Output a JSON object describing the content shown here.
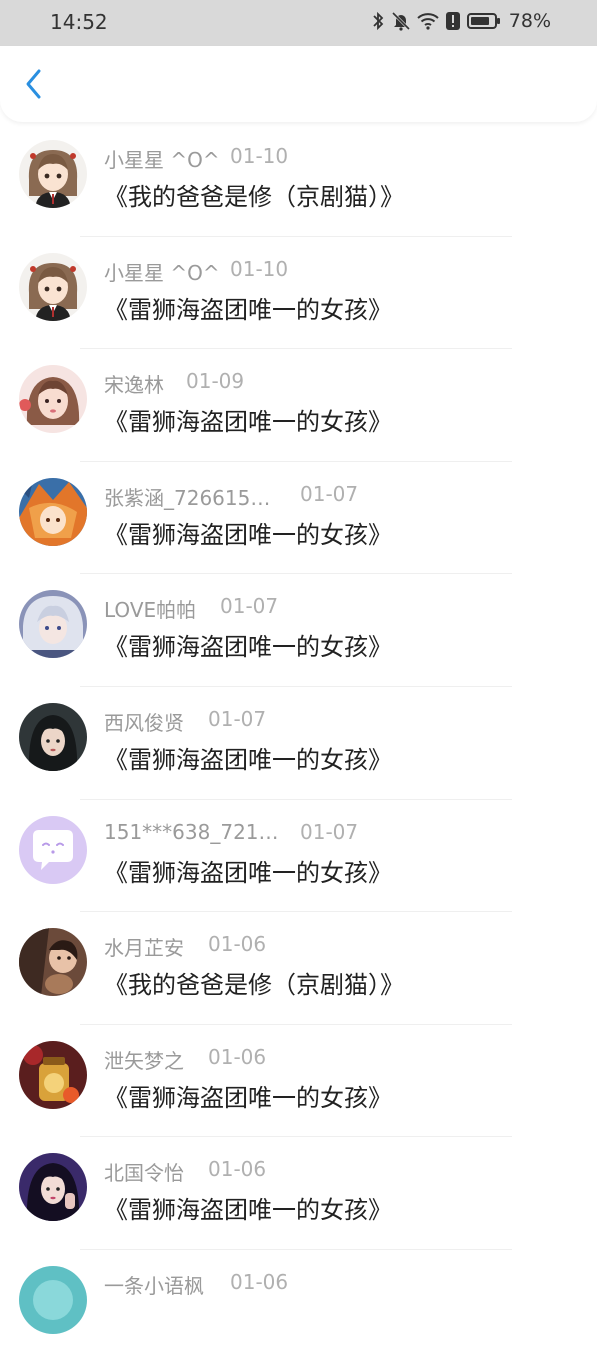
{
  "status_bar": {
    "time": "14:52",
    "battery": "78%",
    "icons": [
      "bluetooth-icon",
      "mute-bell-icon",
      "wifi-icon",
      "alert-icon",
      "battery-icon"
    ]
  },
  "header": {
    "back_icon": "chevron-left-icon",
    "accent_color": "#2a8fe0"
  },
  "comments": [
    {
      "name": "小星星 ^O^",
      "date": "01-10",
      "title": "《我的爸爸是修（京剧猫）》",
      "avatar": "anime-girl"
    },
    {
      "name": "小星星 ^O^",
      "date": "01-10",
      "title": "《雷狮海盗团唯一的女孩》",
      "avatar": "anime-girl"
    },
    {
      "name": "宋逸林",
      "date": "01-09",
      "title": "《雷狮海盗团唯一的女孩》",
      "avatar": "pink-girl"
    },
    {
      "name": "张紫涵_726615…",
      "date": "01-07",
      "title": "《雷狮海盗团唯一的女孩》",
      "avatar": "orange-fox"
    },
    {
      "name": "LOVE帕帕",
      "date": "01-07",
      "title": "《雷狮海盗团唯一的女孩》",
      "avatar": "silver-hair"
    },
    {
      "name": "西风俊贤",
      "date": "01-07",
      "title": "《雷狮海盗团唯一的女孩》",
      "avatar": "dark-hair"
    },
    {
      "name": "151***638_721…",
      "date": "01-07",
      "title": "《雷狮海盗团唯一的女孩》",
      "avatar": "default-chat"
    },
    {
      "name": "水月芷安",
      "date": "01-06",
      "title": "《我的爸爸是修（京剧猫）》",
      "avatar": "brown-photo"
    },
    {
      "name": "泄矢梦之",
      "date": "01-06",
      "title": "《雷狮海盗团唯一的女孩》",
      "avatar": "red-jar"
    },
    {
      "name": "北国令怡",
      "date": "01-06",
      "title": "《雷狮海盗团唯一的女孩》",
      "avatar": "purple-girl"
    },
    {
      "name": "一条小语枫",
      "date": "01-06",
      "title": "",
      "avatar": "teal-partial"
    }
  ]
}
